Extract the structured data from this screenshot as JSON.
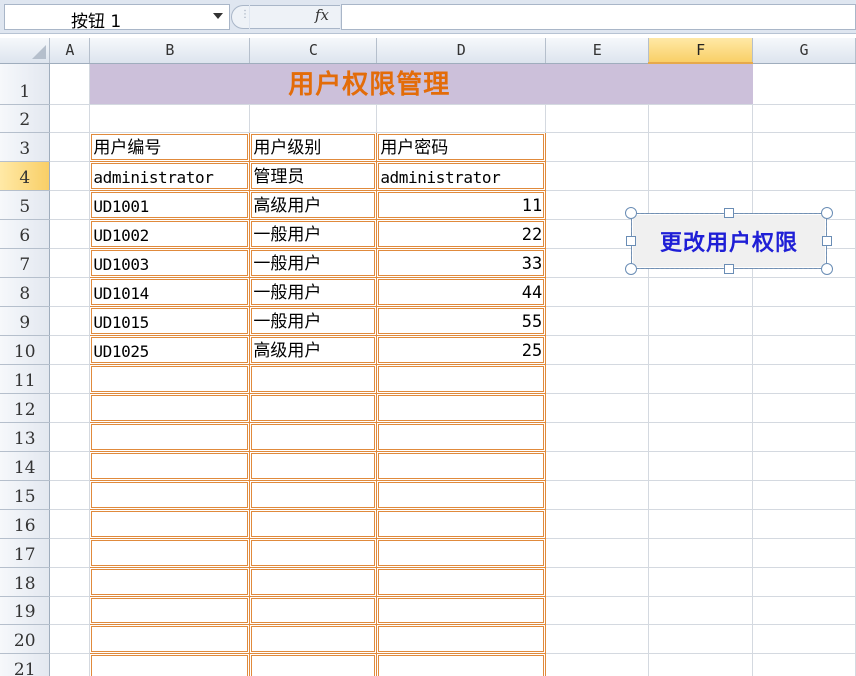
{
  "formula_bar": {
    "name_box_value": "按钮 1",
    "fx_label": "fx",
    "formula_value": ""
  },
  "columns": [
    "A",
    "B",
    "C",
    "D",
    "E",
    "F",
    "G"
  ],
  "selected_column": "F",
  "rows": [
    "1",
    "2",
    "3",
    "4",
    "5",
    "6",
    "7",
    "8",
    "9",
    "10",
    "11",
    "12",
    "13",
    "14",
    "15",
    "16",
    "17",
    "18",
    "19",
    "20",
    "21"
  ],
  "selected_row": "4",
  "sheet": {
    "title": "用户权限管理",
    "headers": [
      "用户编号",
      "用户级别",
      "用户密码"
    ],
    "records": [
      {
        "id": "administrator",
        "level": "管理员",
        "password": "administrator"
      },
      {
        "id": "UD1001",
        "level": "高级用户",
        "password": "11"
      },
      {
        "id": "UD1002",
        "level": "一般用户",
        "password": "22"
      },
      {
        "id": "UD1003",
        "level": "一般用户",
        "password": "33"
      },
      {
        "id": "UD1014",
        "level": "一般用户",
        "password": "44"
      },
      {
        "id": "UD1015",
        "level": "一般用户",
        "password": "55"
      },
      {
        "id": "UD1025",
        "level": "高级用户",
        "password": "25"
      }
    ]
  },
  "form_button": {
    "label": "更改用户权限"
  },
  "colors": {
    "title_fill": "#ccc0da",
    "title_text": "#e36c09",
    "table_border": "#e08a3c",
    "button_text": "#1f1fd6",
    "selected_header": "#f9cf67"
  }
}
